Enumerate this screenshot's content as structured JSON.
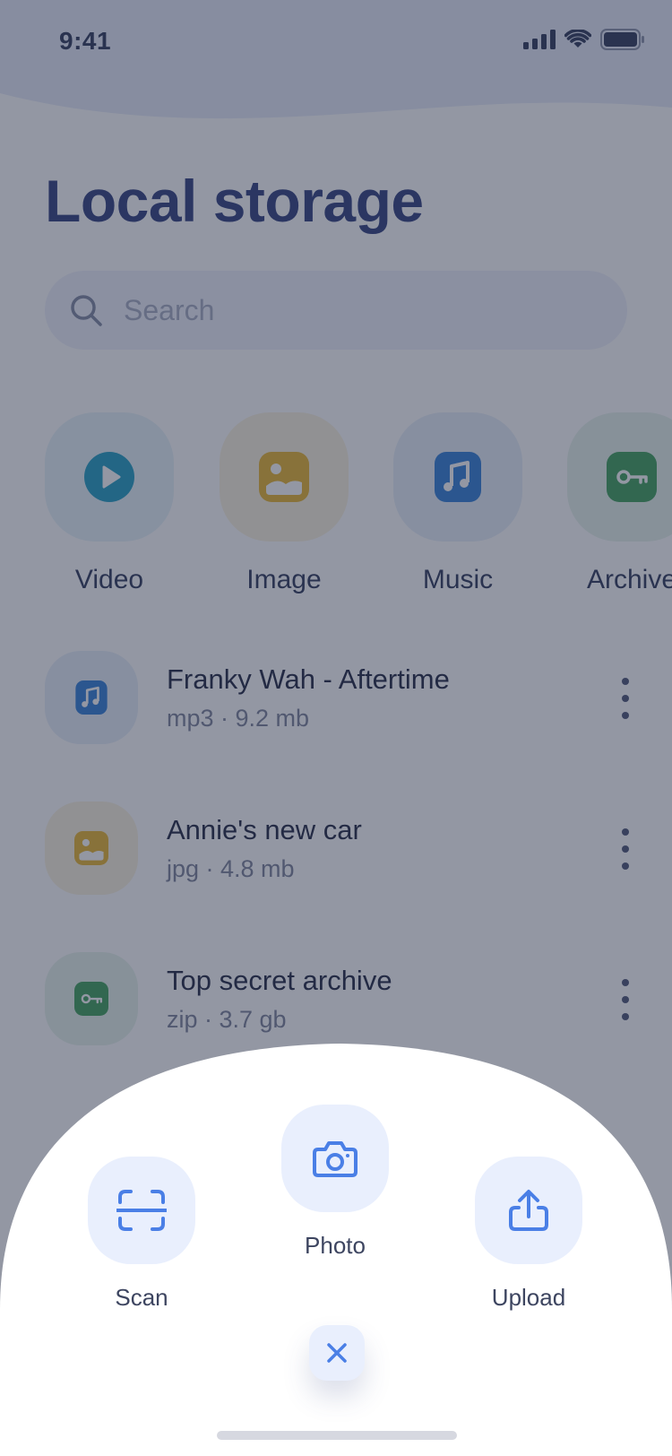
{
  "status_bar": {
    "time": "9:41"
  },
  "page": {
    "title": "Local storage"
  },
  "search": {
    "placeholder": "Search"
  },
  "categories": [
    {
      "label": "Video",
      "icon": "play-icon",
      "color": "#1e9dc2"
    },
    {
      "label": "Image",
      "icon": "image-icon",
      "color": "#e8b52c"
    },
    {
      "label": "Music",
      "icon": "music-icon",
      "color": "#2f7dd6"
    },
    {
      "label": "Archive",
      "icon": "key-icon",
      "color": "#3d9f58"
    }
  ],
  "files": [
    {
      "name": "Franky Wah - Aftertime",
      "meta": "mp3 · 9.2 mb",
      "icon": "music-icon",
      "color": "#2f7dd6"
    },
    {
      "name": "Annie's new car",
      "meta": "jpg · 4.8 mb",
      "icon": "image-icon",
      "color": "#e8b52c"
    },
    {
      "name": "Top secret archive",
      "meta": "zip · 3.7 gb",
      "icon": "key-icon",
      "color": "#3d9f58"
    }
  ],
  "sheet": {
    "actions": [
      {
        "label": "Scan",
        "icon": "scan-icon"
      },
      {
        "label": "Photo",
        "icon": "camera-icon"
      },
      {
        "label": "Upload",
        "icon": "upload-icon"
      }
    ],
    "close_icon": "close-icon",
    "accent": "#4a7fe6"
  }
}
